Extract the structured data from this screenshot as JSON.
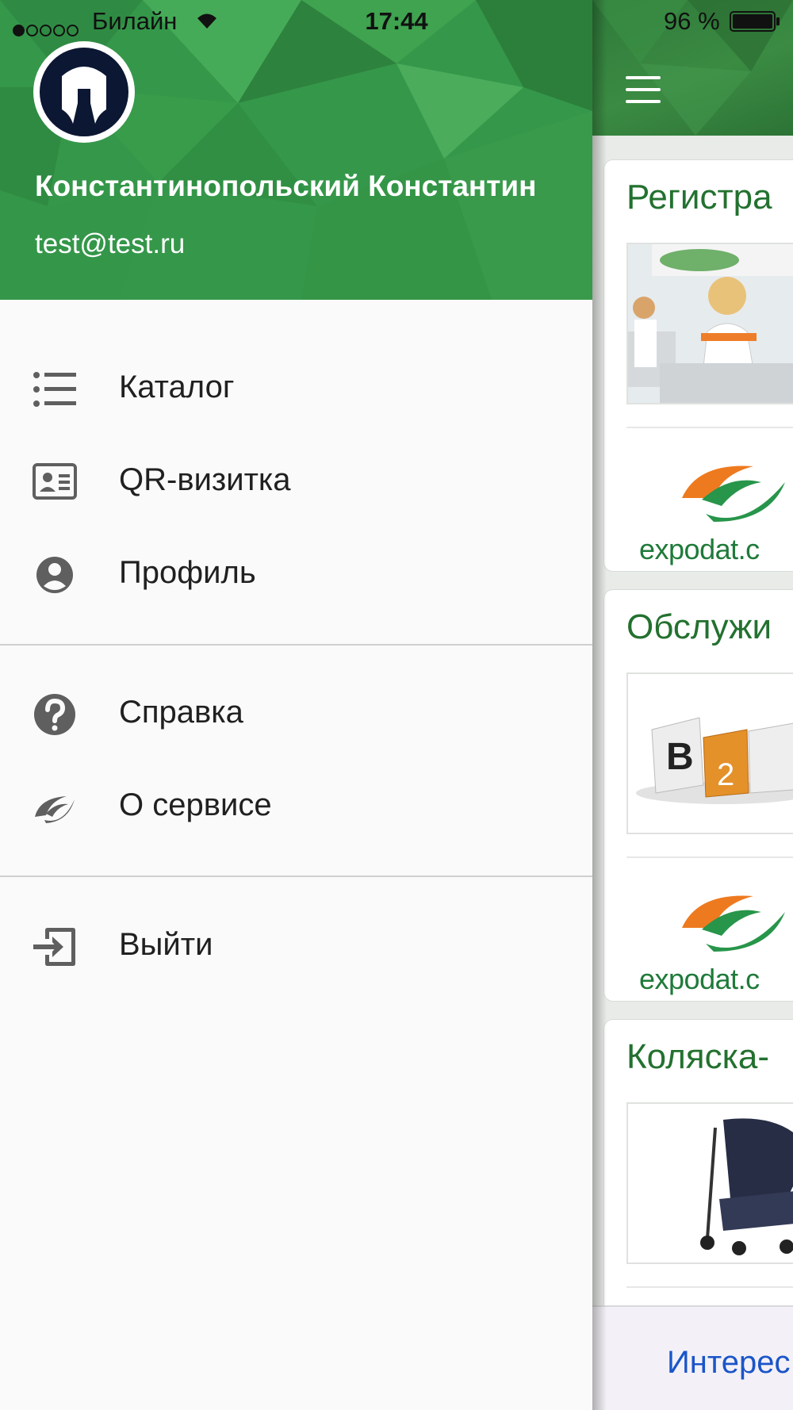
{
  "status_bar": {
    "carrier": "Билайн",
    "time": "17:44",
    "battery": "96 %"
  },
  "drawer": {
    "user": {
      "name": "Константинопольский Константин",
      "email": "test@test.ru"
    },
    "menu_groups": [
      [
        {
          "label": "Каталог",
          "icon": "list-icon"
        },
        {
          "label": "QR-визитка",
          "icon": "id-card-icon"
        },
        {
          "label": "Профиль",
          "icon": "account-circle-icon"
        }
      ],
      [
        {
          "label": "Справка",
          "icon": "help-circle-icon"
        },
        {
          "label": "О сервисе",
          "icon": "expodat-logo-icon"
        }
      ],
      [
        {
          "label": "Выйти",
          "icon": "exit-icon"
        }
      ]
    ]
  },
  "app": {
    "cards": [
      {
        "title": "Регистра",
        "image": "registration-desk-photo",
        "brand": "expodat.c"
      },
      {
        "title": "Обслужи",
        "image": "b2b-cubes-photo",
        "brand": "expodat.c"
      },
      {
        "title": "Коляска-",
        "image": "stroller-photo"
      }
    ],
    "bottom_tab": "Интерес"
  },
  "colors": {
    "header_green": "#35974a",
    "card_title_green": "#23712f",
    "link_blue": "#1a55c9",
    "icon_gray": "#5f5f5f"
  }
}
